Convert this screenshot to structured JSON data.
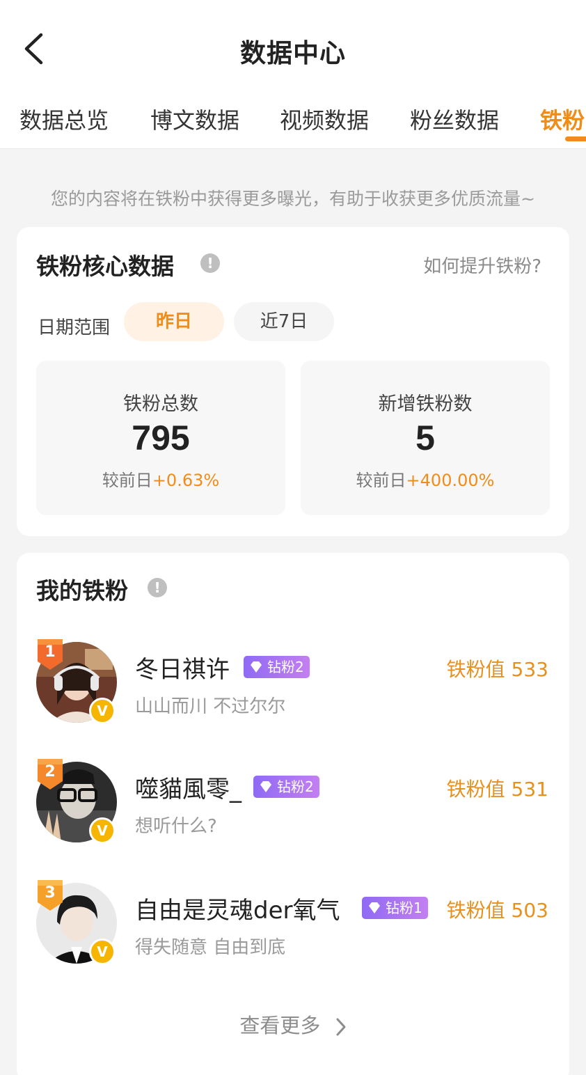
{
  "header": {
    "title": "数据中心",
    "back_icon": "chevron-left-icon"
  },
  "tabs": [
    {
      "label": "数据总览",
      "active": false
    },
    {
      "label": "博文数据",
      "active": false
    },
    {
      "label": "视频数据",
      "active": false
    },
    {
      "label": "粉丝数据",
      "active": false
    },
    {
      "label": "铁粉",
      "active": true
    }
  ],
  "tip": "您的内容将在铁粉中获得更多曝光，有助于收获更多优质流量~",
  "core": {
    "title": "铁粉核心数据",
    "help_link": "如何提升铁粉?",
    "date_label": "日期范围",
    "date_options": [
      "昨日",
      "近7日"
    ],
    "stats": [
      {
        "label": "铁粉总数",
        "value": "795",
        "compare_label": "较前日",
        "compare_value": "+0.63%"
      },
      {
        "label": "新增铁粉数",
        "value": "5",
        "compare_label": "较前日",
        "compare_value": "+400.00%"
      }
    ]
  },
  "my_fans": {
    "title": "我的铁粉",
    "fans": [
      {
        "rank": "1",
        "name": "冬日祺许",
        "level": "钻粉2",
        "bio": "山山而川 不过尔尔",
        "score": "铁粉值 533"
      },
      {
        "rank": "2",
        "name": "噬貓風零_",
        "level": "钻粉2",
        "bio": "想听什么?",
        "score": "铁粉值 531"
      },
      {
        "rank": "3",
        "name": "自由是灵魂der氧气",
        "level": "钻粉1",
        "bio": "得失随意 自由到底",
        "score": "铁粉值 503"
      }
    ],
    "more": "查看更多"
  },
  "colors": {
    "accent": "#f08c1a",
    "verified": "#f6b500",
    "level_badge": "#9b6cf4"
  },
  "icons": {
    "info": "info-icon",
    "verified": "verified-v-icon",
    "gem": "diamond-icon",
    "more": "chevron-right-icon"
  }
}
